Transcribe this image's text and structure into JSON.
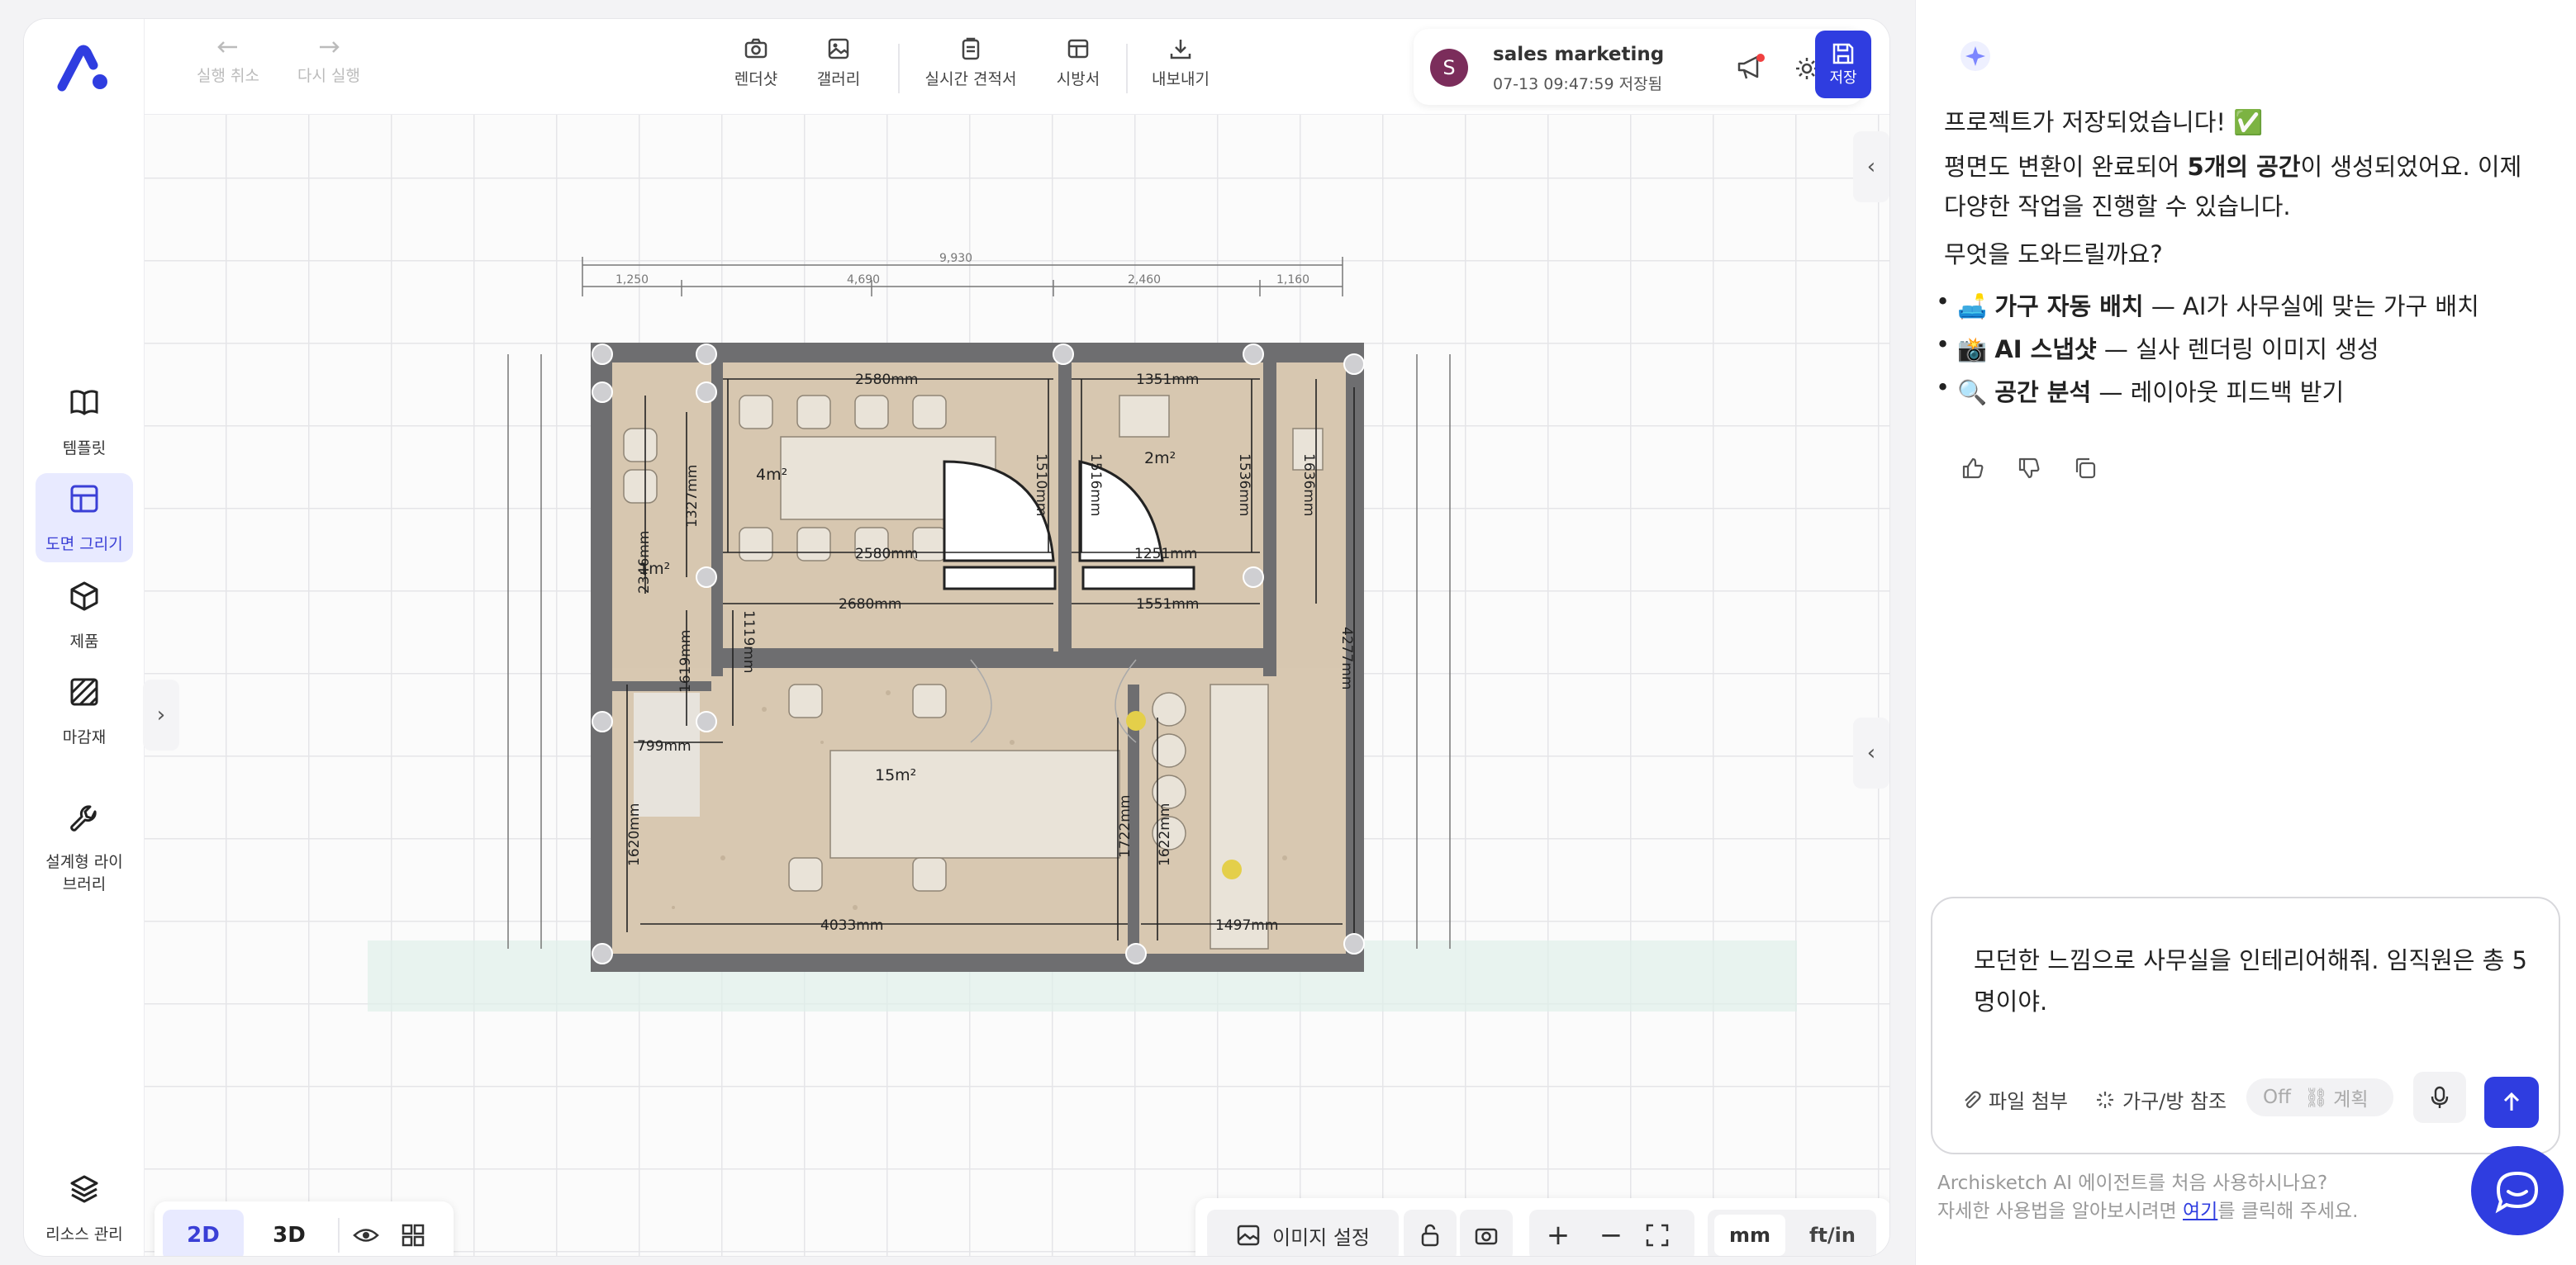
{
  "sidebar": {
    "items": [
      {
        "label": "템플릿"
      },
      {
        "label": "도면 그리기"
      },
      {
        "label": "제품"
      },
      {
        "label": "마감재"
      },
      {
        "label": "설계형 라이브러리"
      }
    ],
    "bottom_label": "리소스 관리"
  },
  "toolbar": {
    "undo": "실행 취소",
    "redo": "다시 실행",
    "render": "렌더샷",
    "gallery": "갤러리",
    "estimate": "실시간 견적서",
    "spec": "시방서",
    "export": "내보내기",
    "save": "저장"
  },
  "user": {
    "initial": "S",
    "name": "sales marketing",
    "saved": "07-13 09:47:59 저장됨"
  },
  "floorplan": {
    "rooms": [
      {
        "label": "4m²"
      },
      {
        "label": "2m²"
      },
      {
        "label": "1m²"
      },
      {
        "label": "15m²"
      }
    ],
    "dims": [
      "2580mm",
      "1351mm",
      "1510mm",
      "1516mm",
      "1536mm",
      "1636mm",
      "1327mm",
      "2346mm",
      "1619mm",
      "2580mm",
      "1251mm",
      "2680mm",
      "1551mm",
      "1119mm",
      "4277mm",
      "799mm",
      "1620mm",
      "1722mm",
      "1622mm",
      "4033mm",
      "1497mm"
    ],
    "outer_dims": [
      "9,930",
      "1,250",
      "4,690",
      "2,460",
      "1,160"
    ]
  },
  "view": {
    "mode_2d": "2D",
    "mode_3d": "3D",
    "image_settings": "이미지 설정",
    "unit_mm": "mm",
    "unit_ftin": "ft/in"
  },
  "chat": {
    "line1": "프로젝트가 저장되었습니다! ✅",
    "line2a": "평면도 변환이 완료되어 ",
    "line2b": "5개의 공간",
    "line2c": "이 생성되었어요. 이제",
    "line3": "다양한 작업을 진행할 수 있습니다.",
    "line4": "무엇을 도와드릴까요?",
    "bullets": [
      {
        "icon": "🛋️",
        "title": "가구 자동 배치",
        "desc": " — AI가 사무실에 맞는 가구 배치"
      },
      {
        "icon": "📸",
        "title": "AI 스냅샷",
        "desc": " — 실사 렌더링 이미지 생성"
      },
      {
        "icon": "🔍",
        "title": "공간 분석",
        "desc": " — 레이아웃 피드백 받기"
      }
    ],
    "input_text": "모던한 느낌으로 사무실을 인테리어해줘. 임직원은 총 5명이야.",
    "attach": "파일 첨부",
    "ref": "가구/방 참조",
    "off": "Off",
    "plan": "계획",
    "footer1": "Archisketch AI 에이전트를 처음 사용하시나요?",
    "footer2a": "자세한 사용법을 알아보시려면 ",
    "footer2b": "여기",
    "footer2c": "를 클릭해 주세요."
  }
}
